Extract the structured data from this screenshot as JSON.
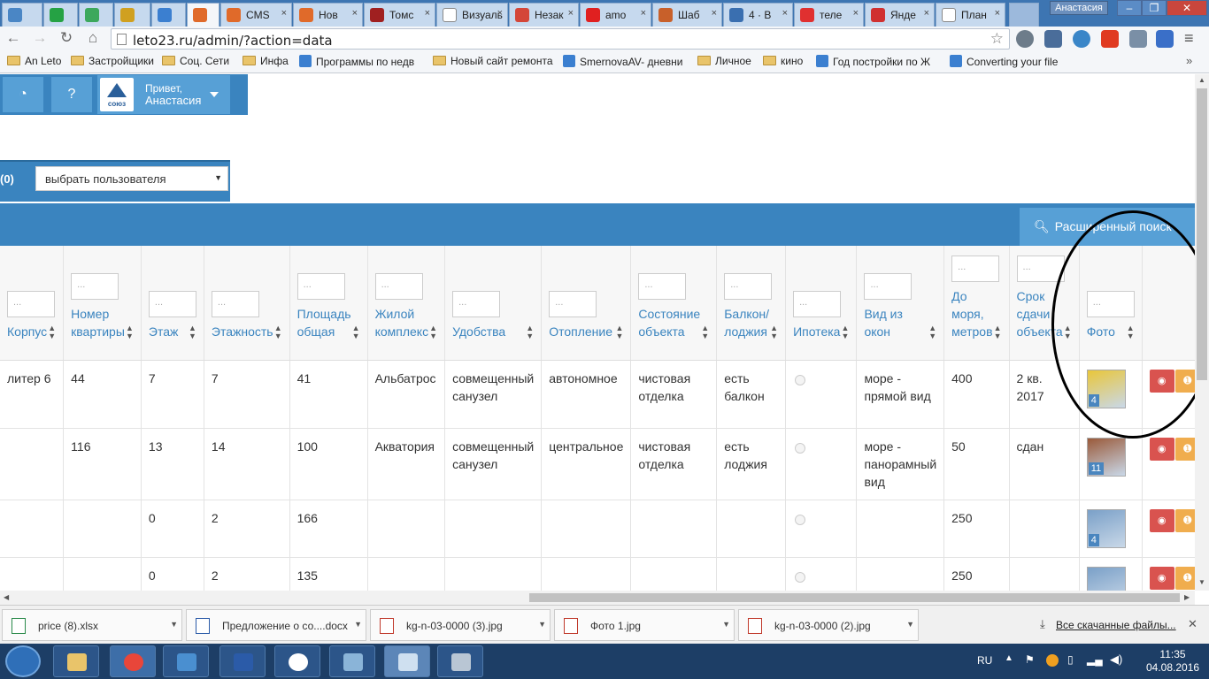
{
  "browser": {
    "user_name": "Анастасия",
    "tabs": [
      {
        "label": "",
        "icon_color": "#4a86c5",
        "active": false
      },
      {
        "label": "",
        "icon_color": "#25a244",
        "active": false
      },
      {
        "label": "",
        "icon_color": "#3ca85c",
        "active": false
      },
      {
        "label": "",
        "icon_color": "#d0a020",
        "active": false
      },
      {
        "label": "",
        "icon_color": "#3b7fd0",
        "active": false
      },
      {
        "label": "",
        "icon_color": "#e06a2a",
        "active": true
      },
      {
        "label": "CMS",
        "icon_color": "#e06a2a",
        "active": false
      },
      {
        "label": "Нов",
        "icon_color": "#e06a2a",
        "active": false
      },
      {
        "label": "Томс",
        "icon_color": "#a02020",
        "active": false
      },
      {
        "label": "Визуаль",
        "icon_color": "#ffffff",
        "active": false
      },
      {
        "label": "Незак",
        "icon_color": "#d44638",
        "active": false
      },
      {
        "label": "amo",
        "icon_color": "#e02020",
        "active": false
      },
      {
        "label": "Шаб",
        "icon_color": "#c8602a",
        "active": false
      },
      {
        "label": "4 · В",
        "icon_color": "#3a6fb0",
        "active": false
      },
      {
        "label": "теле",
        "icon_color": "#e03030",
        "active": false
      },
      {
        "label": "Янде",
        "icon_color": "#d03030",
        "active": false
      },
      {
        "label": "План",
        "icon_color": "#ffffff",
        "active": false
      }
    ],
    "url": "leto23.ru/admin/?action=data",
    "bookmarks": [
      {
        "label": "An Leto",
        "type": "folder"
      },
      {
        "label": "Застройщики",
        "type": "folder"
      },
      {
        "label": "Соц. Сети",
        "type": "folder"
      },
      {
        "label": "Инфа",
        "type": "folder"
      },
      {
        "label": "Программы по недв",
        "type": "site"
      },
      {
        "label": "Новый сайт ремонта",
        "type": "folder"
      },
      {
        "label": "SmernovaAV- дневни",
        "type": "site"
      },
      {
        "label": "Личное",
        "type": "folder"
      },
      {
        "label": "кино",
        "type": "folder"
      },
      {
        "label": "Год постройки по Ж",
        "type": "site"
      },
      {
        "label": "Converting your file",
        "type": "site"
      }
    ]
  },
  "app": {
    "greeting": "Привет,",
    "user_name": "Анастасия",
    "logo_text": "союз",
    "filter_count": "(0)",
    "user_select_placeholder": "выбрать пользователя",
    "advanced_search_label": "Расширенный поиск",
    "columns": [
      "Корпус",
      "Номер квартиры",
      "Этаж",
      "Этажность",
      "Площадь общая",
      "Жилой комплекс",
      "Удобства",
      "Отопление",
      "Состояние объекта",
      "Балкон/ лоджия",
      "Ипотека",
      "Вид из окон",
      "До моря, метров",
      "Срок сдачи объекта",
      "Фото"
    ],
    "filter_placeholder": "...",
    "rows": [
      {
        "korpus": "литер 6",
        "number": "44",
        "floor": "7",
        "floors": "7",
        "area": "41",
        "complex": "Альбатрос",
        "amenities": "совмещенный санузел",
        "heating": "автономное",
        "state": "чистовая отделка",
        "balcony": "есть балкон",
        "view": "море - прямой вид",
        "sea": "400",
        "deadline": "2 кв. 2017",
        "photo_count": "4",
        "photo_color": "#e9c63a"
      },
      {
        "korpus": "",
        "number": "116",
        "floor": "13",
        "floors": "14",
        "area": "100",
        "complex": "Акватория",
        "amenities": "совмещенный санузел",
        "heating": "центральное",
        "state": "чистовая отделка",
        "balcony": "есть лоджия",
        "view": "море - панорамный вид",
        "sea": "50",
        "deadline": "сдан",
        "photo_count": "11",
        "photo_color": "#9a5a3a"
      },
      {
        "korpus": "",
        "number": "",
        "floor": "0",
        "floors": "2",
        "area": "166",
        "complex": "",
        "amenities": "",
        "heating": "",
        "state": "",
        "balcony": "",
        "view": "",
        "sea": "250",
        "deadline": "",
        "photo_count": "4",
        "photo_color": "#7aa0c8"
      },
      {
        "korpus": "",
        "number": "",
        "floor": "0",
        "floors": "2",
        "area": "135",
        "complex": "",
        "amenities": "",
        "heating": "",
        "state": "",
        "balcony": "",
        "view": "",
        "sea": "250",
        "deadline": "",
        "photo_count": "",
        "photo_color": "#7aa0c8"
      }
    ],
    "action_icons": [
      "eye-icon",
      "upload-icon",
      "pencil-icon",
      "close-icon"
    ]
  },
  "downloads": {
    "items": [
      "price (8).xlsx",
      "Предложение о со....docx",
      "kg-n-03-0000 (3).jpg",
      "Фото 1.jpg",
      "kg-n-03-0000 (2).jpg"
    ],
    "show_all_label": "Все скачанные файлы..."
  },
  "taskbar": {
    "lang": "RU",
    "time": "11:35",
    "date": "04.08.2016"
  }
}
